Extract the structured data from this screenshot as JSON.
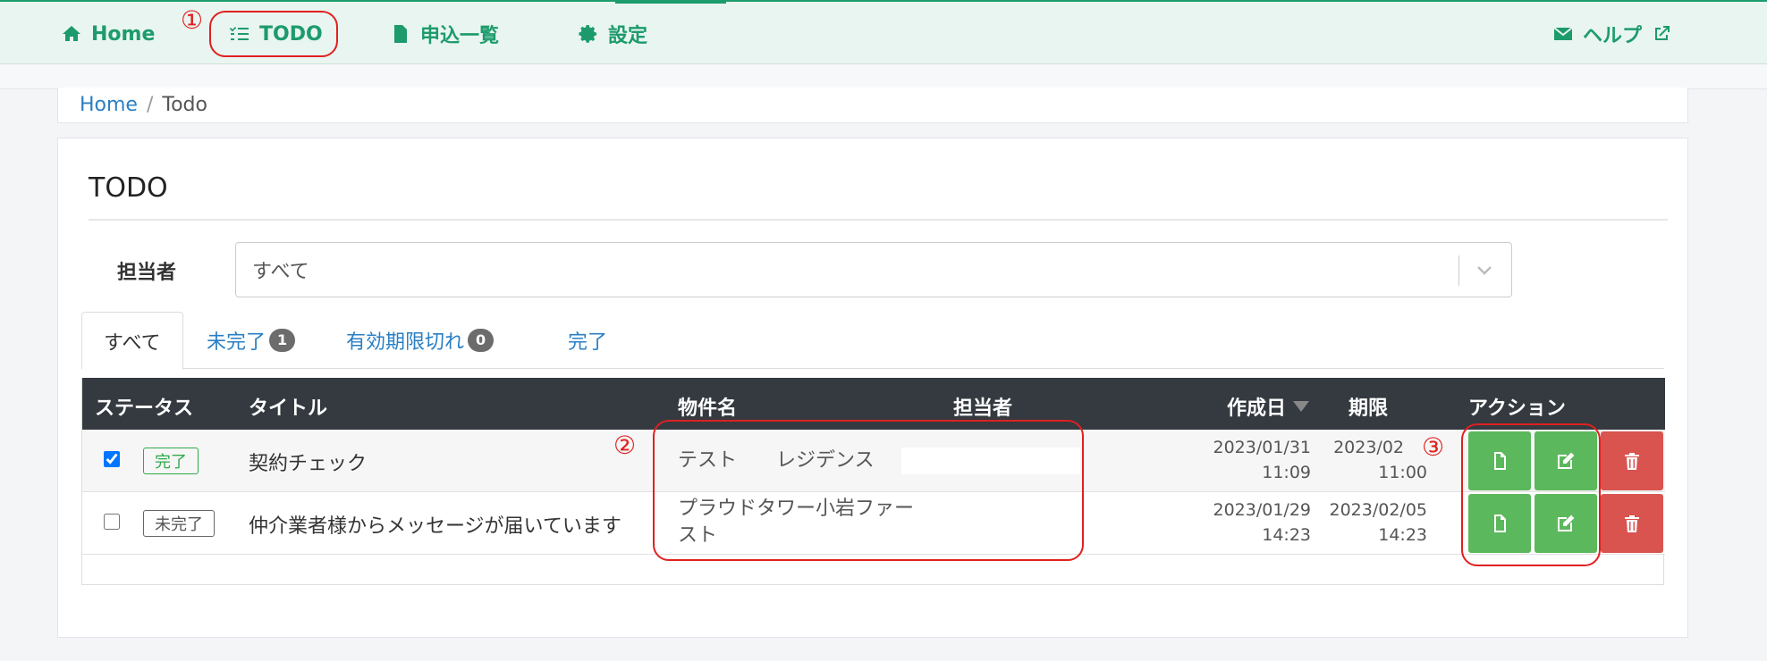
{
  "nav": {
    "home": "Home",
    "todo": "TODO",
    "applications": "申込一覧",
    "settings": "設定",
    "help": "ヘルプ"
  },
  "breadcrumb": {
    "home": "Home",
    "separator": "/",
    "current": "Todo"
  },
  "card": {
    "title": "TODO"
  },
  "filter": {
    "label": "担当者",
    "value": "すべて"
  },
  "tabs": {
    "all": "すべて",
    "incomplete": "未完了",
    "incomplete_count": "1",
    "expired": "有効期限切れ",
    "expired_count": "0",
    "done": "完了"
  },
  "table": {
    "headers": {
      "status": "ステータス",
      "title": "タイトル",
      "property": "物件名",
      "person": "担当者",
      "created": "作成日",
      "deadline": "期限",
      "action": "アクション"
    },
    "rows": [
      {
        "checked": true,
        "status": "完了",
        "title": "契約チェック",
        "property_a": "テスト",
        "property_b": "レジデンス",
        "created_date": "2023/01/31",
        "created_time": "11:09",
        "deadline_date": "2023/02",
        "deadline_time": "11:00"
      },
      {
        "checked": false,
        "status": "未完了",
        "title": "仲介業者様からメッセージが届いています",
        "property_a": "プラウドタワー小岩ファー",
        "property_b": "スト",
        "created_date": "2023/01/29",
        "created_time": "14:23",
        "deadline_date": "2023/02/05",
        "deadline_time": "14:23"
      }
    ]
  },
  "annotations": {
    "one": "①",
    "two": "②",
    "three": "③"
  },
  "colors": {
    "brand_green": "#1d9b6c",
    "header_dark": "#343a40",
    "action_green": "#5cb85c",
    "action_red": "#d9534f",
    "annotation_red": "#e02020"
  },
  "icons": {
    "home": "home-icon",
    "todo": "list-check-icon",
    "applications": "file-icon",
    "settings": "gear-icon",
    "help_mail": "envelope-icon",
    "help_external": "external-link-icon",
    "view": "file-icon",
    "edit": "edit-icon",
    "delete": "trash-icon"
  }
}
